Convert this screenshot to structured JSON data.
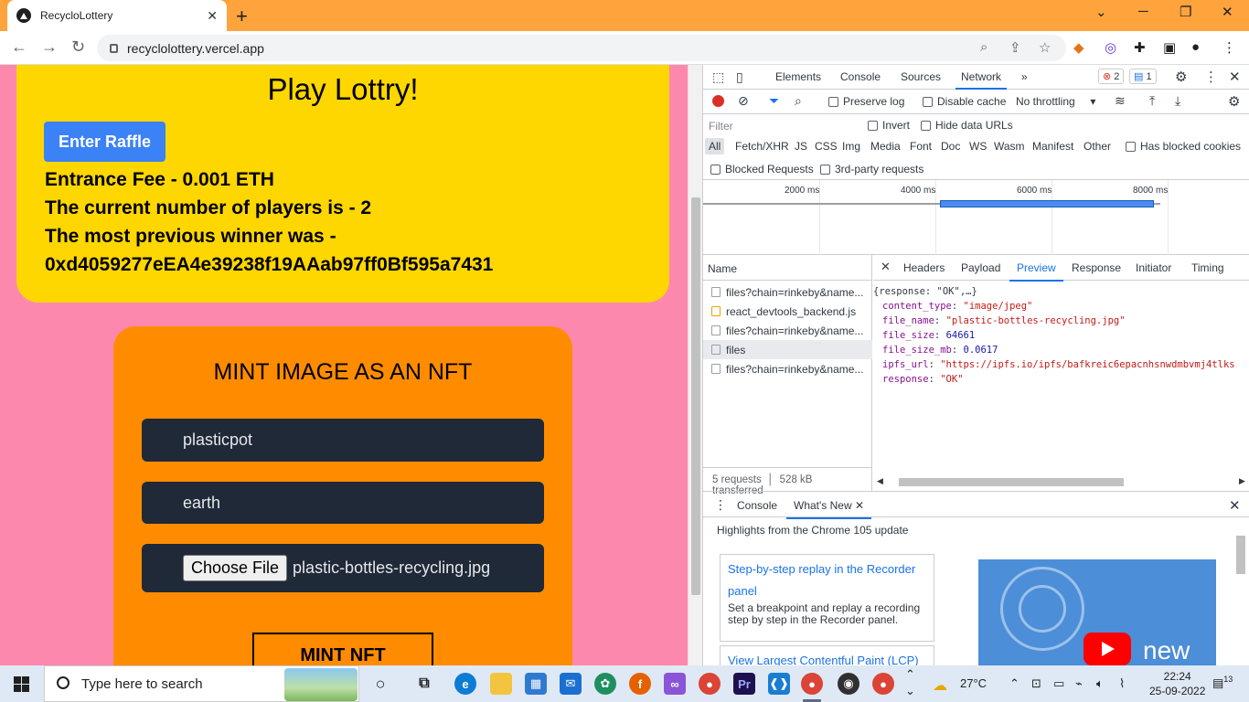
{
  "browser": {
    "tab_title": "RecycloLottery",
    "url": "recyclolottery.vercel.app",
    "new_tab": "+",
    "close": "✕",
    "minimize": "─",
    "maximize": "❐",
    "restore": "⌄"
  },
  "lottery": {
    "title": "Play Lottry!",
    "enter_button": "Enter Raffle",
    "entrance_fee": "Entrance Fee - 0.001 ETH",
    "players": "The current number of players is - 2",
    "winner_label": "The most previous winner was -",
    "winner_address": "0xd4059277eEA4e39238f19AAab97ff0Bf595a7431"
  },
  "mint": {
    "title": "MINT IMAGE AS AN NFT",
    "name_value": "plasticpot",
    "description_value": "earth",
    "choose_file": "Choose File",
    "file_name": "plastic-bottles-recycling.jpg",
    "mint_button": "MINT NFT"
  },
  "devtools": {
    "tabs": [
      "Elements",
      "Console",
      "Sources",
      "Network"
    ],
    "more_tabs": "»",
    "error_count": "2",
    "message_count": "1",
    "preserve_log": "Preserve log",
    "disable_cache": "Disable cache",
    "throttling": "No throttling",
    "filter_placeholder": "Filter",
    "invert": "Invert",
    "hide_data_urls": "Hide data URLs",
    "types": [
      "All",
      "Fetch/XHR",
      "JS",
      "CSS",
      "Img",
      "Media",
      "Font",
      "Doc",
      "WS",
      "Wasm",
      "Manifest",
      "Other"
    ],
    "has_blocked_cookies": "Has blocked cookies",
    "blocked_requests": "Blocked Requests",
    "third_party": "3rd-party requests",
    "timeline_labels": [
      "2000 ms",
      "4000 ms",
      "6000 ms",
      "8000 ms"
    ],
    "name_header": "Name",
    "requests": [
      "files?chain=rinkeby&name...",
      "react_devtools_backend.js",
      "files?chain=rinkeby&name...",
      "files",
      "files?chain=rinkeby&name..."
    ],
    "summary_requests": "5 requests",
    "summary_transferred": "528 kB transferred",
    "detail_tabs": [
      "Headers",
      "Payload",
      "Preview",
      "Response",
      "Initiator",
      "Timing"
    ],
    "preview": {
      "root": "{response: \"OK\",…}",
      "content_type_key": "content_type",
      "content_type_val": "\"image/jpeg\"",
      "file_name_key": "file_name",
      "file_name_val": "\"plastic-bottles-recycling.jpg\"",
      "file_size_key": "file_size",
      "file_size_val": "64661",
      "file_size_mb_key": "file_size_mb",
      "file_size_mb_val": "0.0617",
      "ipfs_url_key": "ipfs_url",
      "ipfs_url_val": "\"https://ipfs.io/ipfs/bafkreic6epacnhsnwdmbvmj4tlks",
      "response_key": "response",
      "response_val": "\"OK\""
    },
    "drawer_tabs": [
      "Console",
      "What's New"
    ],
    "whatsnew_title": "Highlights from the Chrome 105 update",
    "card1_link": "Step-by-step replay in the Recorder panel",
    "card1_desc": "Set a breakpoint and replay a recording step by step in the Recorder panel.",
    "card2_link": "View Largest Contentful Paint (LCP)",
    "video_label": "new"
  },
  "taskbar": {
    "search_placeholder": "Type here to search",
    "weather": "27°C",
    "time": "22:24",
    "date": "25-09-2022",
    "notifications": "13"
  }
}
